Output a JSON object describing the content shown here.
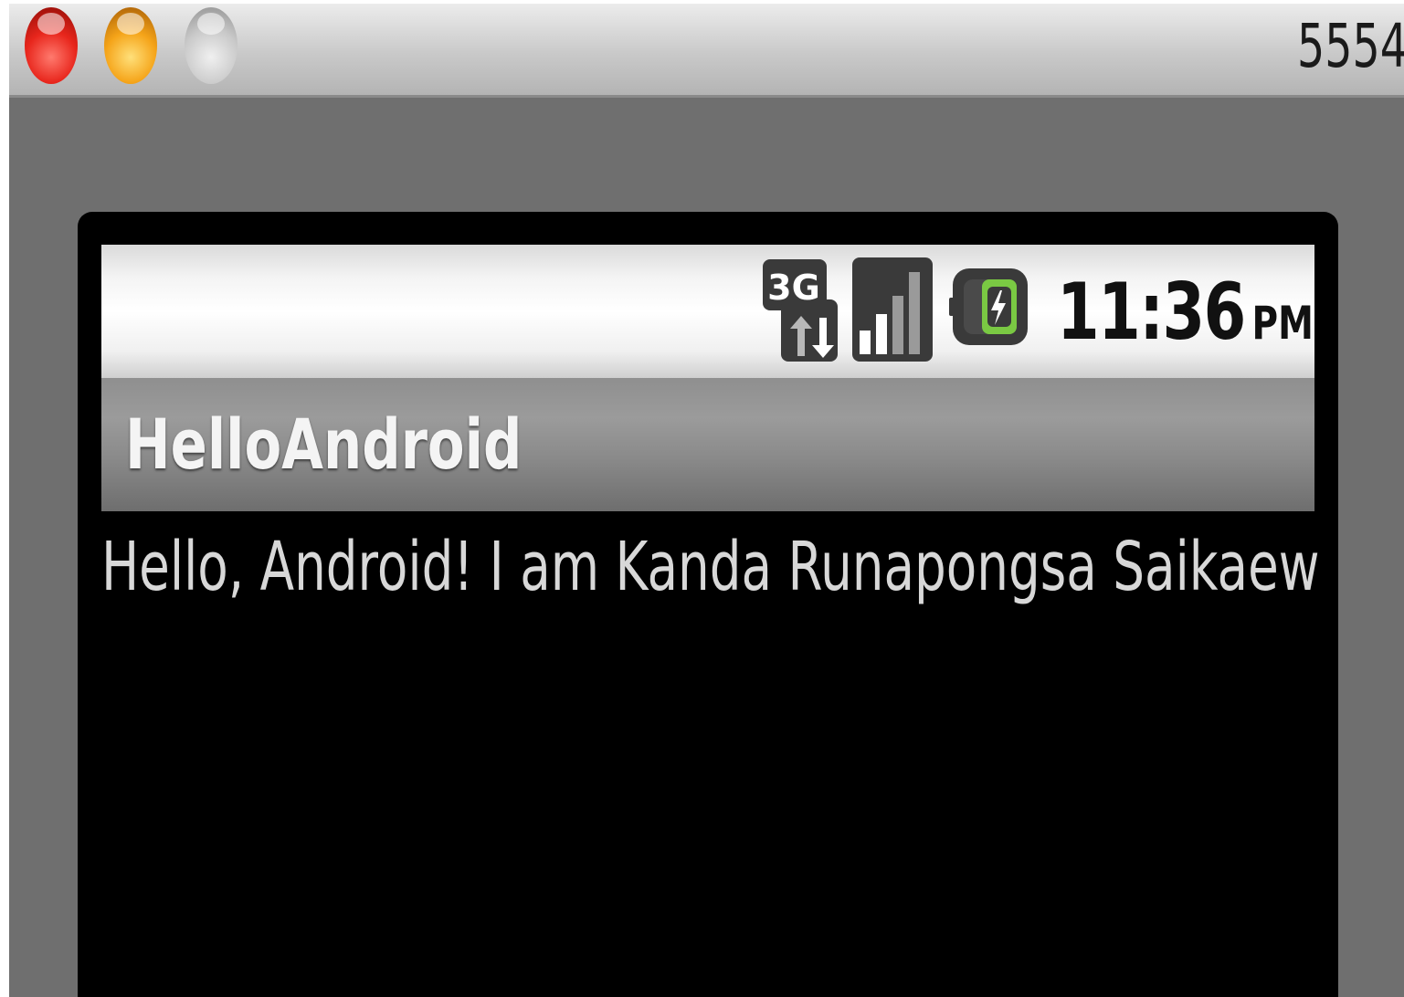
{
  "window": {
    "title": "5554"
  },
  "statusbar": {
    "network_type": "3G",
    "time": "11:36",
    "ampm": "PM",
    "icons": [
      "3g-data-icon",
      "signal-icon",
      "battery-charging-icon"
    ]
  },
  "app": {
    "title": "HelloAndroid",
    "message": "Hello, Android! I am Kanda Runapongsa Saikaew"
  },
  "colors": {
    "close": "#e8261c",
    "minimize": "#f5a419",
    "zoom": "#c9c9c9",
    "battery_accent": "#7ac943"
  }
}
